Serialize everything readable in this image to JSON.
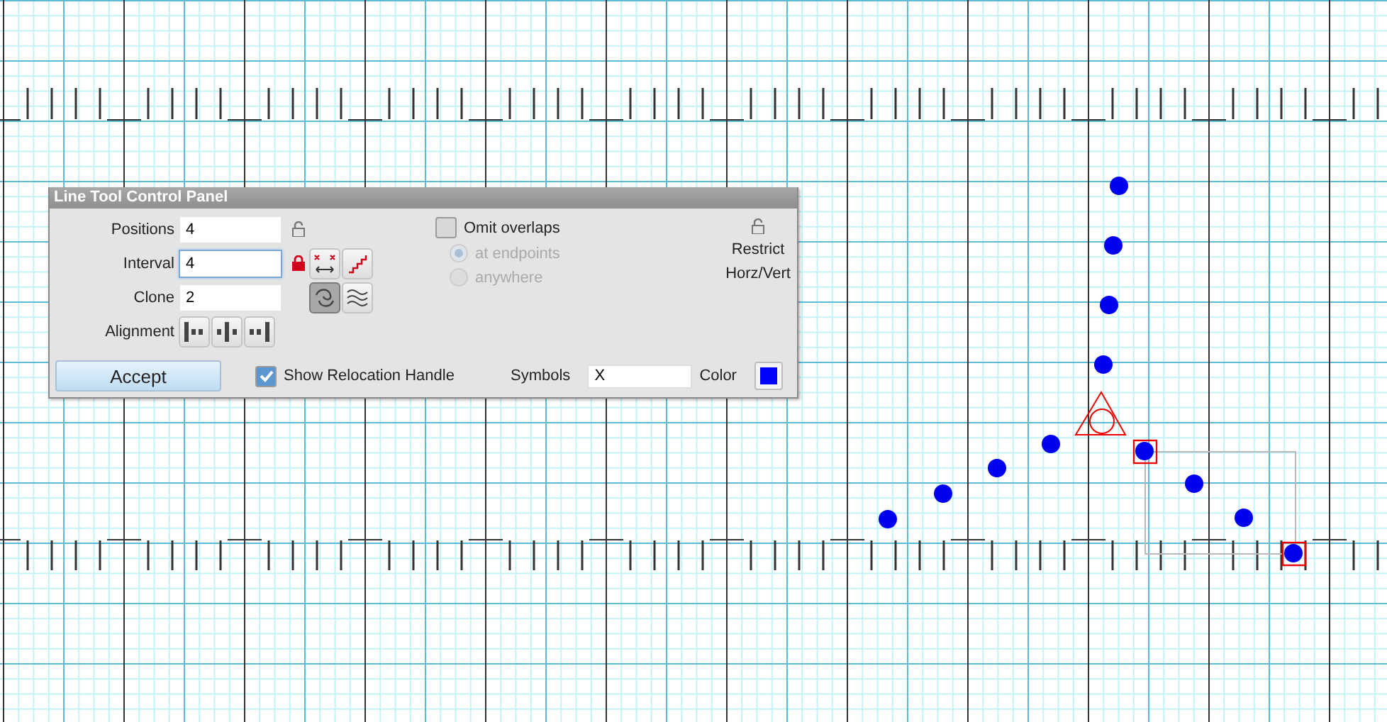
{
  "panel": {
    "title": "Line Tool Control Panel",
    "fields": [
      {
        "label": "Positions",
        "value": "4",
        "focused": false,
        "locked": false
      },
      {
        "label": "Interval",
        "value": "4",
        "focused": true,
        "locked": true,
        "tools": [
          {
            "kind": "spacing",
            "selected": false
          },
          {
            "kind": "stairs",
            "selected": false
          }
        ]
      },
      {
        "label": "Clone",
        "value": "2",
        "focused": false,
        "tools": [
          {
            "kind": "loop",
            "selected": true
          },
          {
            "kind": "waves",
            "selected": false
          }
        ]
      }
    ],
    "alignment": {
      "label": "Alignment",
      "options": [
        {
          "kind": "left",
          "selected": false
        },
        {
          "kind": "center",
          "selected": false
        },
        {
          "kind": "right",
          "selected": false
        }
      ]
    },
    "omit_overlaps": {
      "label": "Omit overlaps",
      "checked": false,
      "options": [
        {
          "label": "at endpoints",
          "selected": true,
          "disabled": true
        },
        {
          "label": "anywhere",
          "selected": false,
          "disabled": true
        }
      ]
    },
    "restrict": {
      "locked": false,
      "lines": [
        "Restrict",
        "Horz/Vert"
      ]
    },
    "accept": "Accept",
    "show_relocation_handle": {
      "label": "Show Relocation Handle",
      "checked": true
    },
    "symbols": {
      "label": "Symbols",
      "value": "X"
    },
    "color": {
      "label": "Color",
      "color": "#0000ff"
    }
  }
}
